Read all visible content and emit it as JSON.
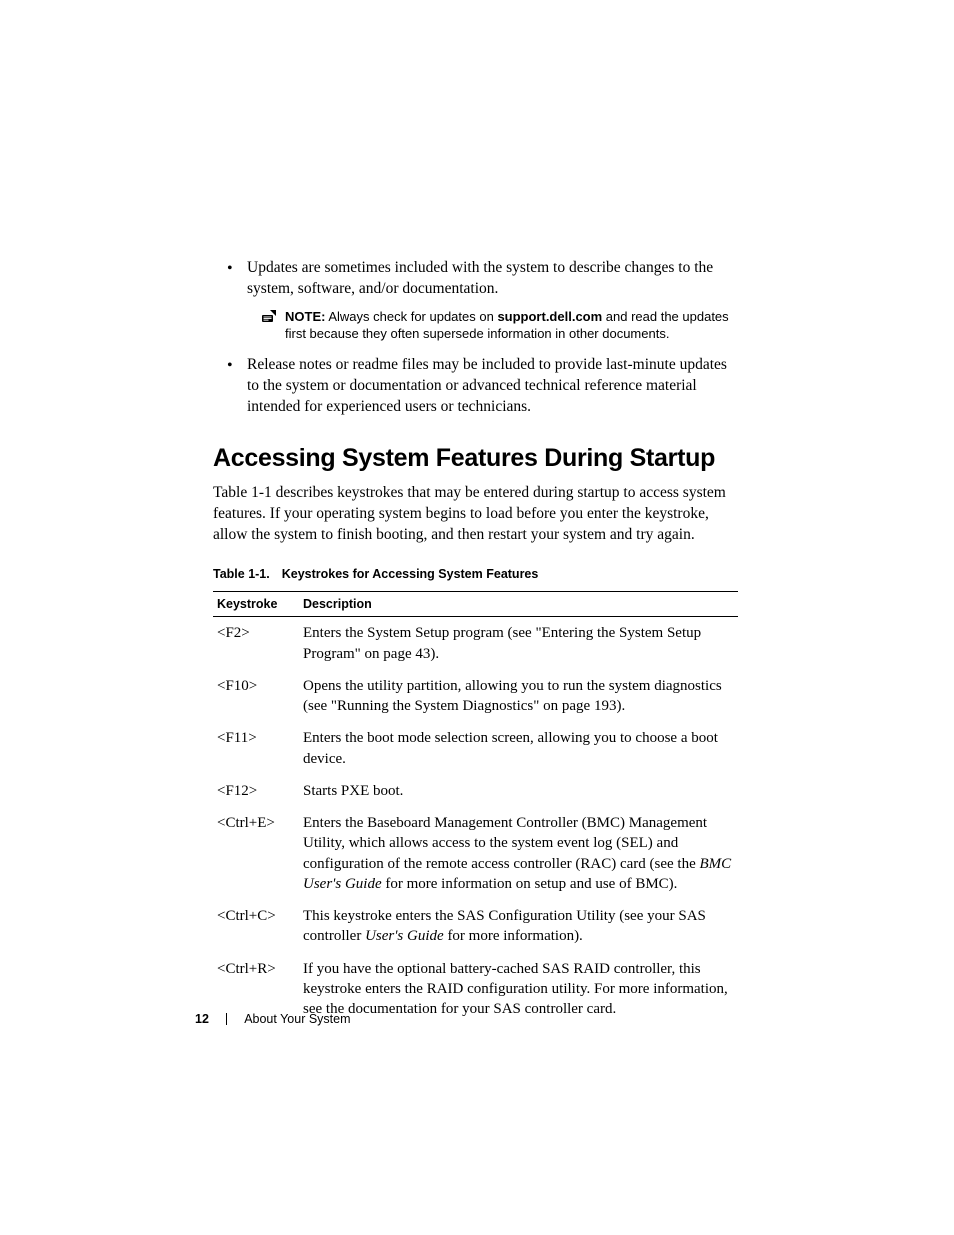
{
  "bullets": {
    "item1": "Updates are sometimes included with the system to describe changes to the system, software, and/or documentation.",
    "item2": "Release notes or readme files may be included to provide last-minute updates to the system or documentation or advanced technical reference material intended for experienced users or technicians."
  },
  "note": {
    "label": "NOTE:",
    "pre": " Always check for updates on ",
    "link": "support.dell.com",
    "post": " and read the updates first because they often supersede information in other documents."
  },
  "heading": "Accessing System Features During Startup",
  "intro": "Table 1-1 describes keystrokes that may be entered during startup to access system features. If your operating system begins to load before you enter the keystroke, allow the system to finish booting, and then restart your system and try again.",
  "table": {
    "caption_label": "Table 1-1.",
    "caption_title": "Keystrokes for Accessing System Features",
    "headers": {
      "k": "Keystroke",
      "d": "Description"
    },
    "rows": {
      "r0": {
        "key": "<F2>",
        "desc": "Enters the System Setup program (see \"Entering the System Setup Program\" on page 43)."
      },
      "r1": {
        "key": "<F10>",
        "desc": "Opens the utility partition, allowing you to run the system diagnostics (see \"Running the System Diagnostics\" on page 193)."
      },
      "r2": {
        "key": "<F11>",
        "desc": "Enters the boot mode selection screen, allowing you to choose a boot device."
      },
      "r3": {
        "key": "<F12>",
        "desc": "Starts PXE boot."
      },
      "r4": {
        "key": "<Ctrl+E>",
        "desc_pre": "Enters the Baseboard Management Controller (BMC) Management Utility, which allows access to the system event log (SEL) and configuration of the remote access controller (RAC) card (see the ",
        "desc_italic": "BMC User's Guide",
        "desc_post": " for more information on setup and use of BMC)."
      },
      "r5": {
        "key": "<Ctrl+C>",
        "desc_pre": "This keystroke enters the SAS Configuration Utility (see your SAS controller ",
        "desc_italic": "User's Guide",
        "desc_post": " for more information)."
      },
      "r6": {
        "key": "<Ctrl+R>",
        "desc": "If you have the optional battery-cached SAS RAID controller, this keystroke enters the RAID configuration utility. For more information, see the documentation for your SAS controller card."
      }
    }
  },
  "footer": {
    "page": "12",
    "section": "About Your System"
  }
}
